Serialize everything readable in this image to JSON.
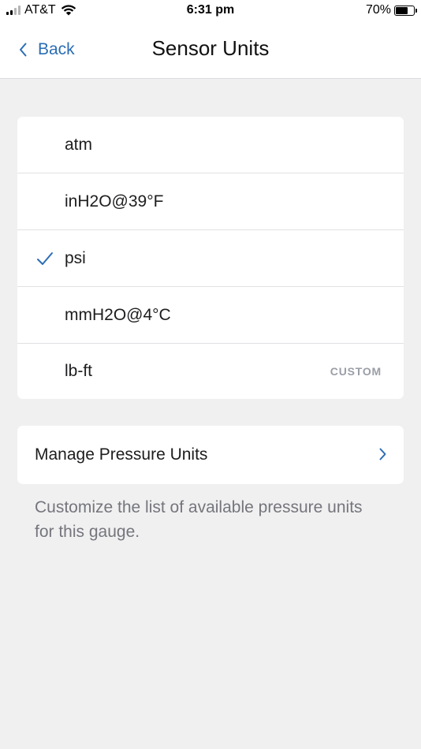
{
  "status_bar": {
    "carrier": "AT&T",
    "time": "6:31 pm",
    "battery": "70%",
    "battery_level": 0.7
  },
  "nav": {
    "back_label": "Back",
    "title": "Sensor Units"
  },
  "units": [
    {
      "label": "atm",
      "selected": false,
      "tag": ""
    },
    {
      "label": "inH2O@39°F",
      "selected": false,
      "tag": ""
    },
    {
      "label": "psi",
      "selected": true,
      "tag": ""
    },
    {
      "label": "mmH2O@4°C",
      "selected": false,
      "tag": ""
    },
    {
      "label": "lb-ft",
      "selected": false,
      "tag": "CUSTOM"
    }
  ],
  "manage": {
    "label": "Manage Pressure Units",
    "description": "Customize the list of available pressure units for this gauge."
  },
  "colors": {
    "accent": "#2a6db5",
    "background": "#f0f0f1",
    "secondary_text": "#74767c"
  },
  "icons": {
    "back": "chevron-left-icon",
    "check": "checkmark-icon",
    "manage": "chevron-right-icon"
  }
}
